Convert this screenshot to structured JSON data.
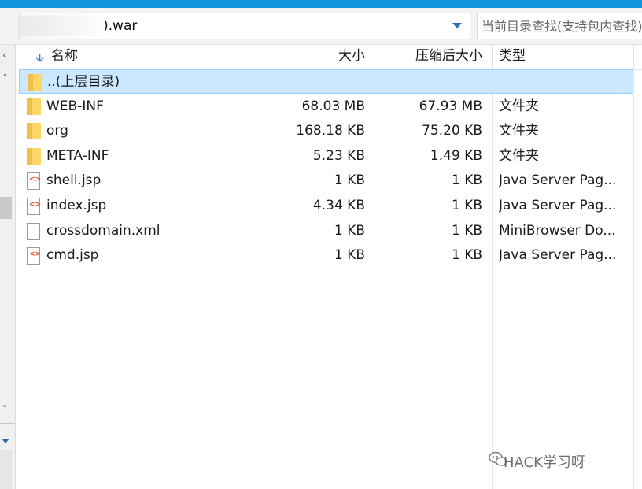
{
  "address": {
    "path_text": ").war",
    "search_placeholder": "当前目录查找(支持包内查找)"
  },
  "columns": {
    "name": "名称",
    "size": "大小",
    "compressed_size": "压缩后大小",
    "type": "类型"
  },
  "rows": [
    {
      "name": "..(上层目录)",
      "size": "",
      "compressed": "",
      "type": "",
      "icon": "folder-icon"
    },
    {
      "name": "WEB-INF",
      "size": "68.03 MB",
      "compressed": "67.93 MB",
      "type": "文件夹",
      "icon": "folder-icon"
    },
    {
      "name": "org",
      "size": "168.18 KB",
      "compressed": "75.20 KB",
      "type": "文件夹",
      "icon": "folder-icon"
    },
    {
      "name": "META-INF",
      "size": "5.23 KB",
      "compressed": "1.49 KB",
      "type": "文件夹",
      "icon": "folder-icon"
    },
    {
      "name": "shell.jsp",
      "size": "1 KB",
      "compressed": "1 KB",
      "type": "Java Server Pag...",
      "icon": "jsp-file-icon"
    },
    {
      "name": "index.jsp",
      "size": "4.34 KB",
      "compressed": "1 KB",
      "type": "Java Server Pag...",
      "icon": "jsp-file-icon"
    },
    {
      "name": "crossdomain.xml",
      "size": "1 KB",
      "compressed": "1 KB",
      "type": "MiniBrowser Do...",
      "icon": "document-icon"
    },
    {
      "name": "cmd.jsp",
      "size": "1 KB",
      "compressed": "1 KB",
      "type": "Java Server Pag...",
      "icon": "jsp-file-icon"
    }
  ],
  "watermark": "HACK学习呀",
  "colors": {
    "selection": "#cce8ff",
    "folder": "#ffd766",
    "accent": "#1296db"
  }
}
